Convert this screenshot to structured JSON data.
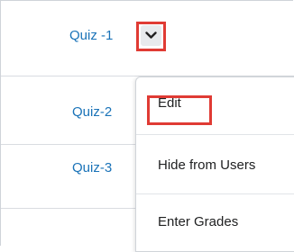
{
  "rows": [
    {
      "label": "Quiz -1"
    },
    {
      "label": "Quiz-2"
    },
    {
      "label": "Quiz-3"
    }
  ],
  "dropdown": {
    "toggle_icon": "chevron-down-icon",
    "items": [
      {
        "label": "Edit"
      },
      {
        "label": "Hide from Users"
      },
      {
        "label": "Enter Grades"
      }
    ]
  },
  "colors": {
    "link": "#1a73b8",
    "highlight": "#e03b34"
  }
}
